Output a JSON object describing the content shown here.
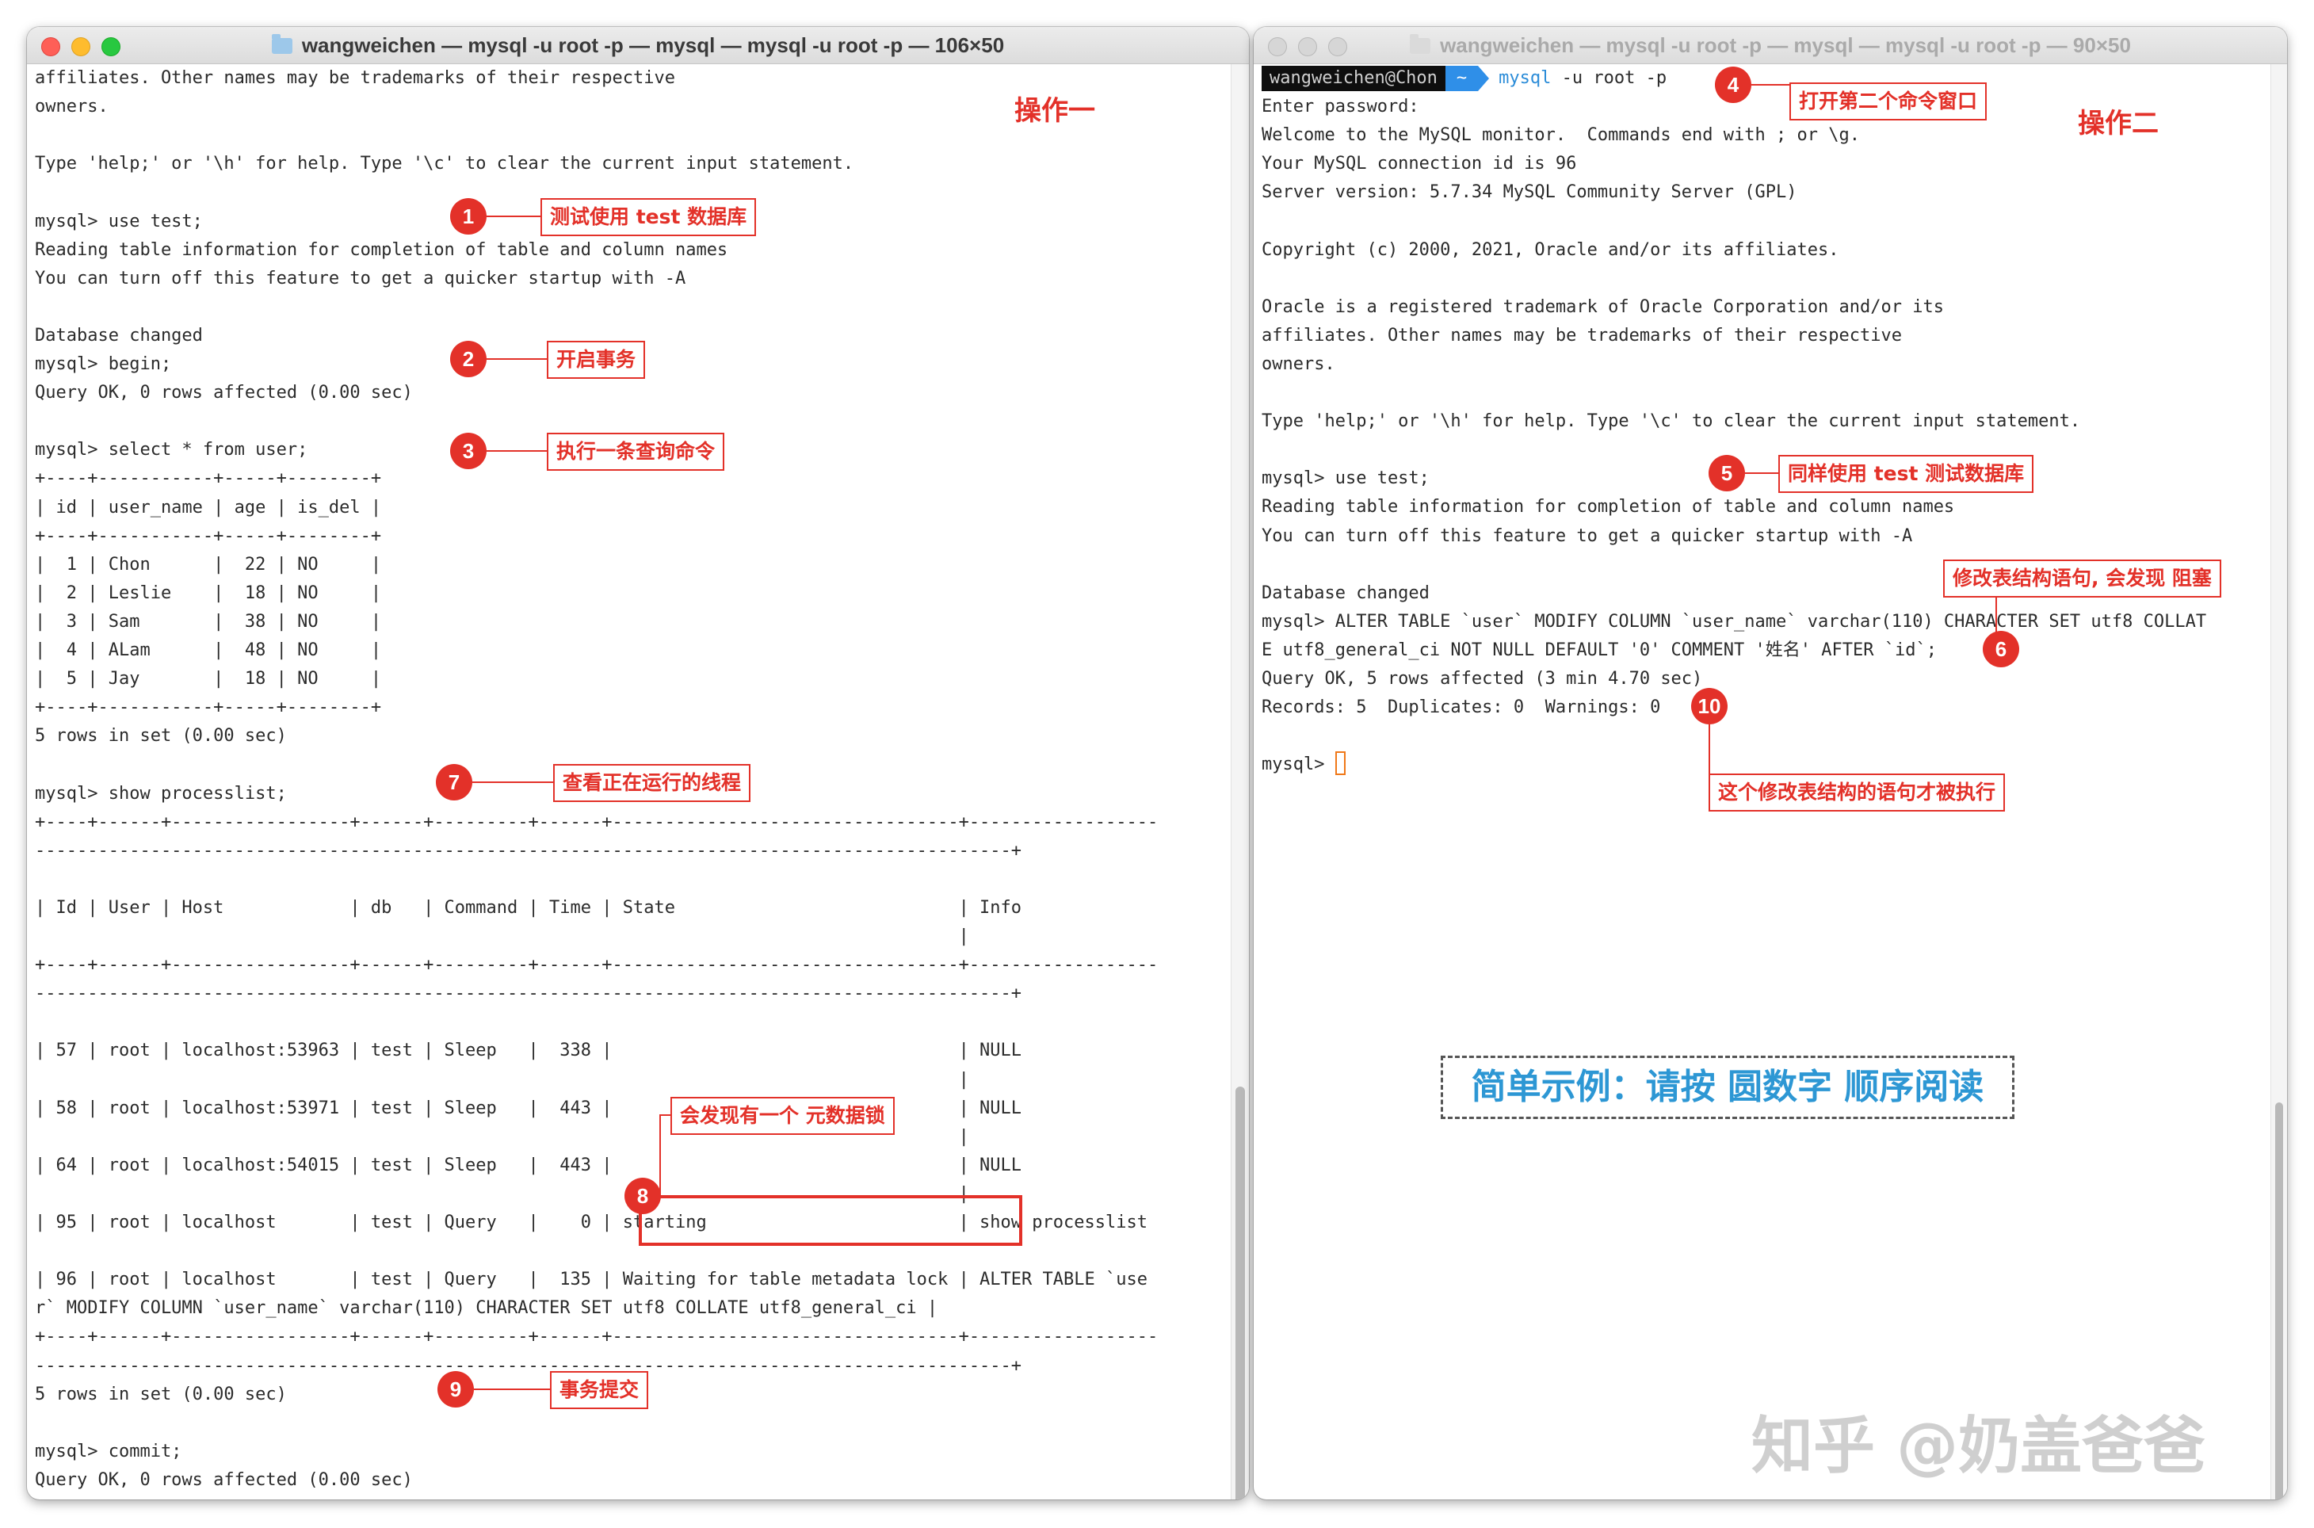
{
  "left_window": {
    "title": "wangweichen — mysql -u root -p — mysql — mysql -u root -p — 106×50",
    "lines": [
      "affiliates. Other names may be trademarks of their respective",
      "owners.",
      "",
      "Type 'help;' or '\\h' for help. Type '\\c' to clear the current input statement.",
      "",
      "mysql> use test;",
      "Reading table information for completion of table and column names",
      "You can turn off this feature to get a quicker startup with -A",
      "",
      "Database changed",
      "mysql> begin;",
      "Query OK, 0 rows affected (0.00 sec)",
      "",
      "mysql> select * from user;",
      "+----+-----------+-----+--------+",
      "| id | user_name | age | is_del |",
      "+----+-----------+-----+--------+",
      "|  1 | Chon      |  22 | NO     |",
      "|  2 | Leslie    |  18 | NO     |",
      "|  3 | Sam       |  38 | NO     |",
      "|  4 | ALam      |  48 | NO     |",
      "|  5 | Jay       |  18 | NO     |",
      "+----+-----------+-----+--------+",
      "5 rows in set (0.00 sec)",
      "",
      "mysql> show processlist;",
      "+----+------+-----------------+------+---------+------+---------------------------------+------------------",
      "---------------------------------------------------------------------------------------------+",
      "",
      "| Id | User | Host            | db   | Command | Time | State                           | Info",
      "                                                                                        |",
      "+----+------+-----------------+------+---------+------+---------------------------------+------------------",
      "---------------------------------------------------------------------------------------------+",
      "",
      "| 57 | root | localhost:53963 | test | Sleep   |  338 |                                 | NULL",
      "                                                                                        |",
      "| 58 | root | localhost:53971 | test | Sleep   |  443 |                                 | NULL",
      "                                                                                        |",
      "| 64 | root | localhost:54015 | test | Sleep   |  443 |                                 | NULL",
      "                                                                                        |",
      "| 95 | root | localhost       | test | Query   |    0 | starting                        | show processlist",
      "",
      "| 96 | root | localhost       | test | Query   |  135 | Waiting for table metadata lock | ALTER TABLE `use",
      "r` MODIFY COLUMN `user_name` varchar(110) CHARACTER SET utf8 COLLATE utf8_general_ci |",
      "+----+------+-----------------+------+---------+------+---------------------------------+------------------",
      "---------------------------------------------------------------------------------------------+",
      "5 rows in set (0.00 sec)",
      "",
      "mysql> commit;",
      "Query OK, 0 rows affected (0.00 sec)",
      "",
      "mysql> "
    ]
  },
  "right_window": {
    "title": "wangweichen — mysql -u root -p — mysql — mysql -u root -p — 90×50",
    "prompt": {
      "user_host": "wangweichen@Chon",
      "dir": "~",
      "cmd": "mysql",
      "args": " -u root -p"
    },
    "lines": [
      "Enter password:",
      "Welcome to the MySQL monitor.  Commands end with ; or \\g.",
      "Your MySQL connection id is 96",
      "Server version: 5.7.34 MySQL Community Server (GPL)",
      "",
      "Copyright (c) 2000, 2021, Oracle and/or its affiliates.",
      "",
      "Oracle is a registered trademark of Oracle Corporation and/or its",
      "affiliates. Other names may be trademarks of their respective",
      "owners.",
      "",
      "Type 'help;' or '\\h' for help. Type '\\c' to clear the current input statement.",
      "",
      "mysql> use test;",
      "Reading table information for completion of table and column names",
      "You can turn off this feature to get a quicker startup with -A",
      "",
      "Database changed",
      "mysql> ALTER TABLE `user` MODIFY COLUMN `user_name` varchar(110) CHARACTER SET utf8 COLLAT",
      "E utf8_general_ci NOT NULL DEFAULT '0' COMMENT '姓名' AFTER `id`;",
      "Query OK, 5 rows affected (3 min 4.70 sec)",
      "Records: 5  Duplicates: 0  Warnings: 0",
      "",
      "mysql> "
    ]
  },
  "annotations": {
    "heading_left": "操作一",
    "heading_right": "操作二",
    "steps": [
      {
        "num": "1",
        "label": "测试使用 test 数据库"
      },
      {
        "num": "2",
        "label": "开启事务"
      },
      {
        "num": "3",
        "label": "执行一条查询命令"
      },
      {
        "num": "4",
        "label": "打开第二个命令窗口"
      },
      {
        "num": "5",
        "label": "同样使用 test 测试数据库"
      },
      {
        "num": "6",
        "label": "修改表结构语句, 会发现 阻塞"
      },
      {
        "num": "7",
        "label": "查看正在运行的线程"
      },
      {
        "num": "8",
        "label": "会发现有一个 元数据锁"
      },
      {
        "num": "9",
        "label": "事务提交"
      },
      {
        "num": "10",
        "label": "这个修改表结构的语句才被执行"
      }
    ],
    "reading_hint": "简单示例：请按 圆数字 顺序阅读",
    "watermark": "知乎 @奶盖爸爸",
    "accent_color": "#e33129",
    "hint_color": "#2d97d4"
  }
}
